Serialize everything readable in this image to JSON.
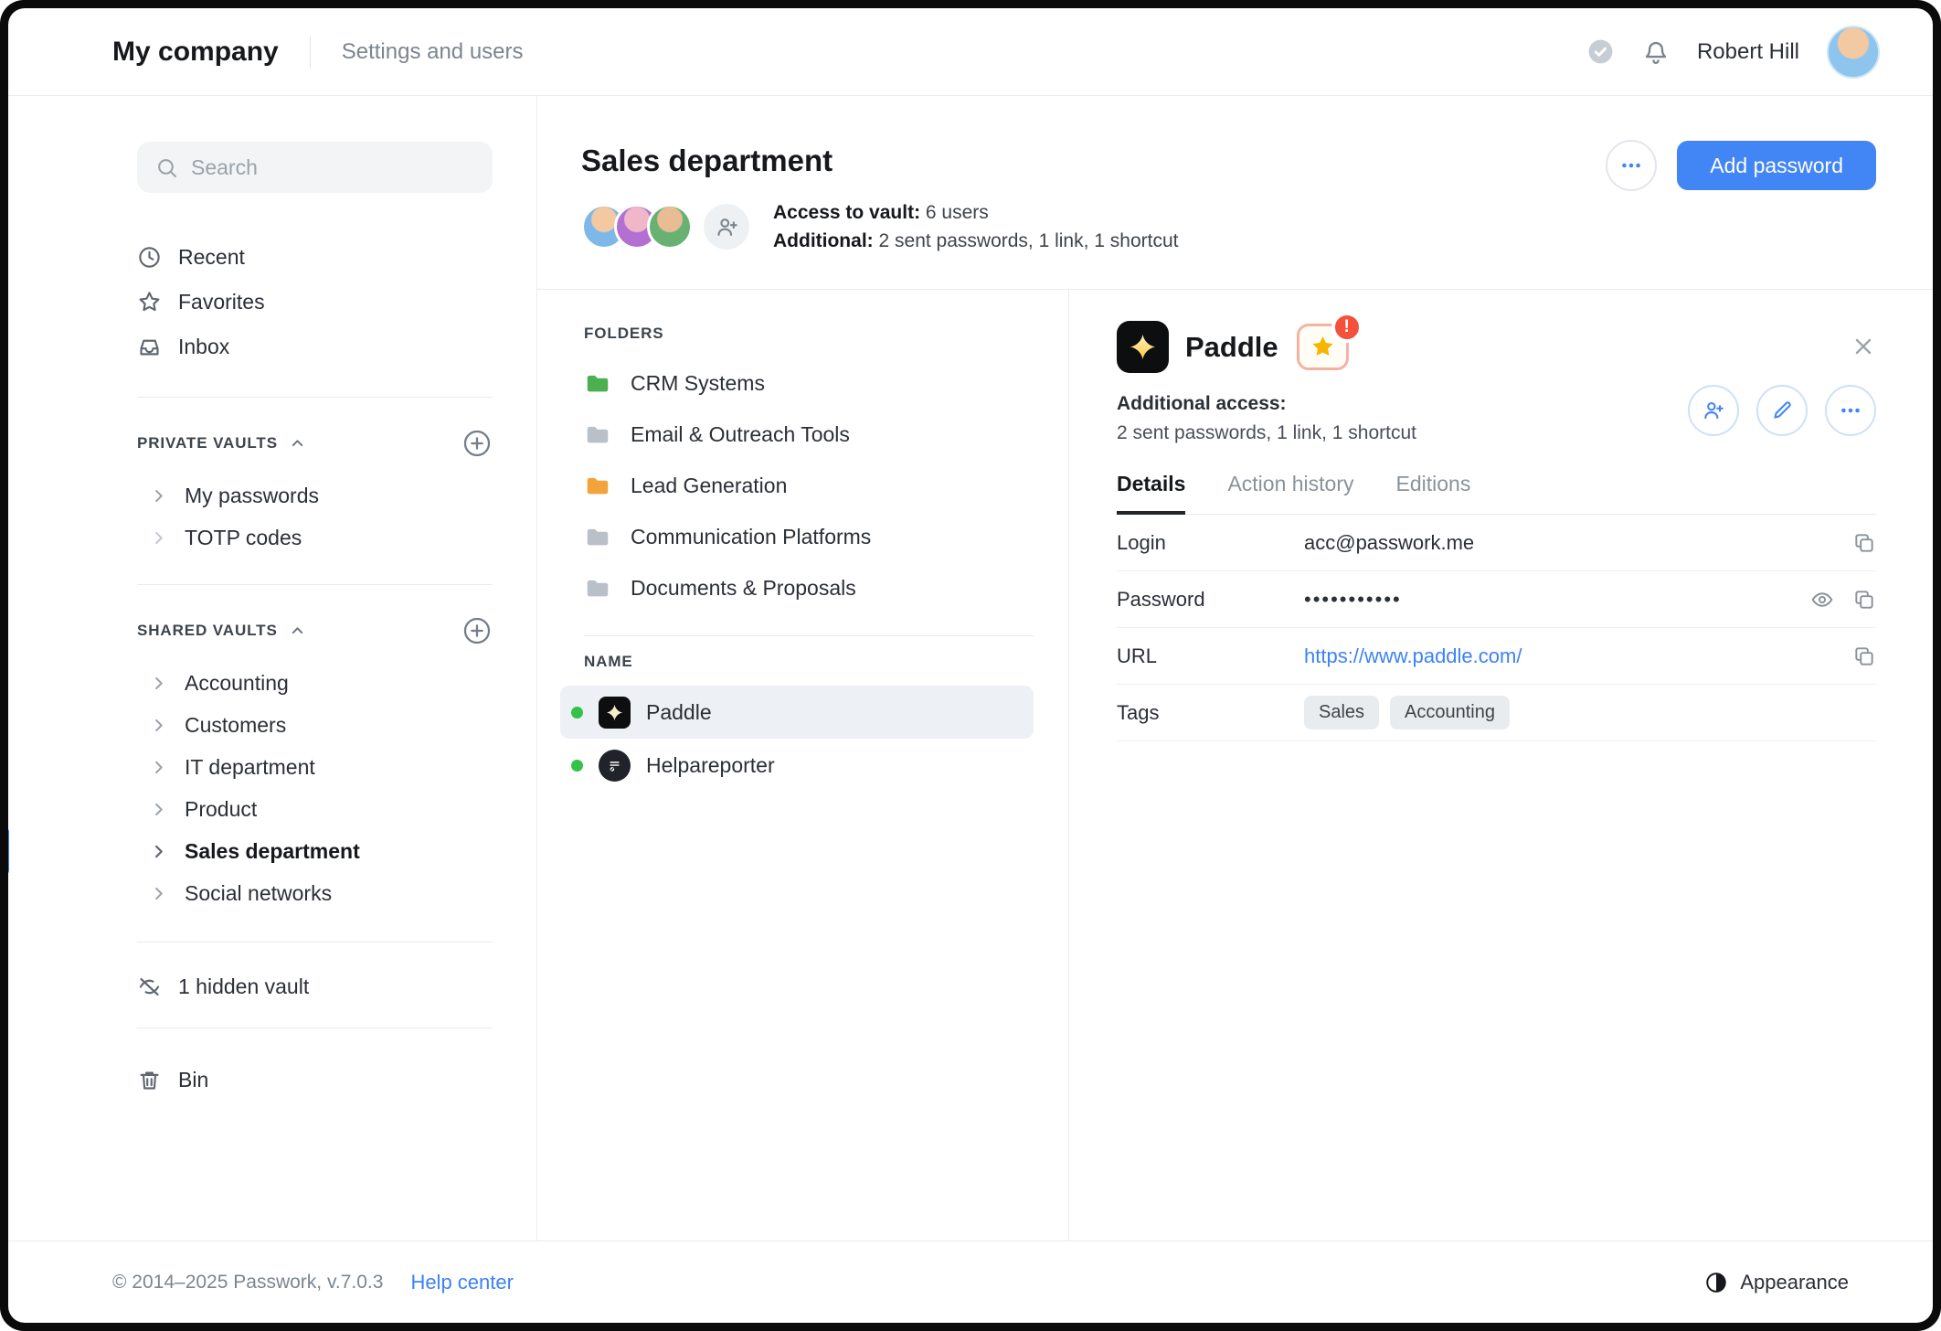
{
  "colors": {
    "accent": "#4285f4",
    "link": "#3b82f6",
    "active_marker": "#3b7ef2",
    "selected_row_bg": "#edf0f4",
    "green_dot": "#35c24b",
    "star_yellow": "#f7b500",
    "alert_red": "#f4503a"
  },
  "topbar": {
    "company": "My company",
    "section": "Settings and users",
    "user": "Robert Hill"
  },
  "sidebar": {
    "search_placeholder": "Search",
    "nav": [
      {
        "label": "Recent",
        "icon": "clock-icon"
      },
      {
        "label": "Favorites",
        "icon": "star-icon"
      },
      {
        "label": "Inbox",
        "icon": "inbox-icon"
      }
    ],
    "private_vaults": {
      "title": "PRIVATE VAULTS",
      "items": [
        {
          "label": "My passwords"
        },
        {
          "label": "TOTP codes"
        }
      ]
    },
    "shared_vaults": {
      "title": "SHARED VAULTS",
      "items": [
        {
          "label": "Accounting"
        },
        {
          "label": "Customers"
        },
        {
          "label": "IT department"
        },
        {
          "label": "Product"
        },
        {
          "label": "Sales department",
          "active": true
        },
        {
          "label": "Social networks"
        }
      ]
    },
    "hidden_vault": "1 hidden vault",
    "bin": "Bin"
  },
  "vault_header": {
    "title": "Sales department",
    "access_label": "Access to vault:",
    "access_value": "6 users",
    "additional_label": "Additional:",
    "additional_value": "2 sent passwords, 1 link, 1 shortcut",
    "add_password_label": "Add password"
  },
  "folders": {
    "title": "FOLDERS",
    "items": [
      {
        "name": "CRM Systems",
        "color": "#4caf50"
      },
      {
        "name": "Email & Outreach Tools",
        "color": "#b9c0c8"
      },
      {
        "name": "Lead Generation",
        "color": "#f2a33c"
      },
      {
        "name": "Communication Platforms",
        "color": "#b9c0c8"
      },
      {
        "name": "Documents & Proposals",
        "color": "#b9c0c8"
      }
    ]
  },
  "records": {
    "title": "NAME",
    "items": [
      {
        "name": "Paddle",
        "selected": true
      },
      {
        "name": "Helpareporter",
        "selected": false
      }
    ]
  },
  "detail": {
    "title": "Paddle",
    "alert": "!",
    "additional_access_label": "Additional access:",
    "additional_access_value": "2 sent passwords, 1 link, 1 shortcut",
    "tabs": [
      {
        "label": "Details",
        "active": true
      },
      {
        "label": "Action history"
      },
      {
        "label": "Editions"
      }
    ],
    "fields": {
      "login_label": "Login",
      "login_value": "acc@passwork.me",
      "password_label": "Password",
      "password_value": "•••••••••••",
      "url_label": "URL",
      "url_value": "https://www.paddle.com/",
      "tags_label": "Tags",
      "tags": [
        {
          "label": "Sales"
        },
        {
          "label": "Accounting"
        }
      ]
    }
  },
  "footer": {
    "copyright": "© 2014–2025 Passwork, v.7.0.3",
    "help": "Help center",
    "appearance": "Appearance"
  }
}
